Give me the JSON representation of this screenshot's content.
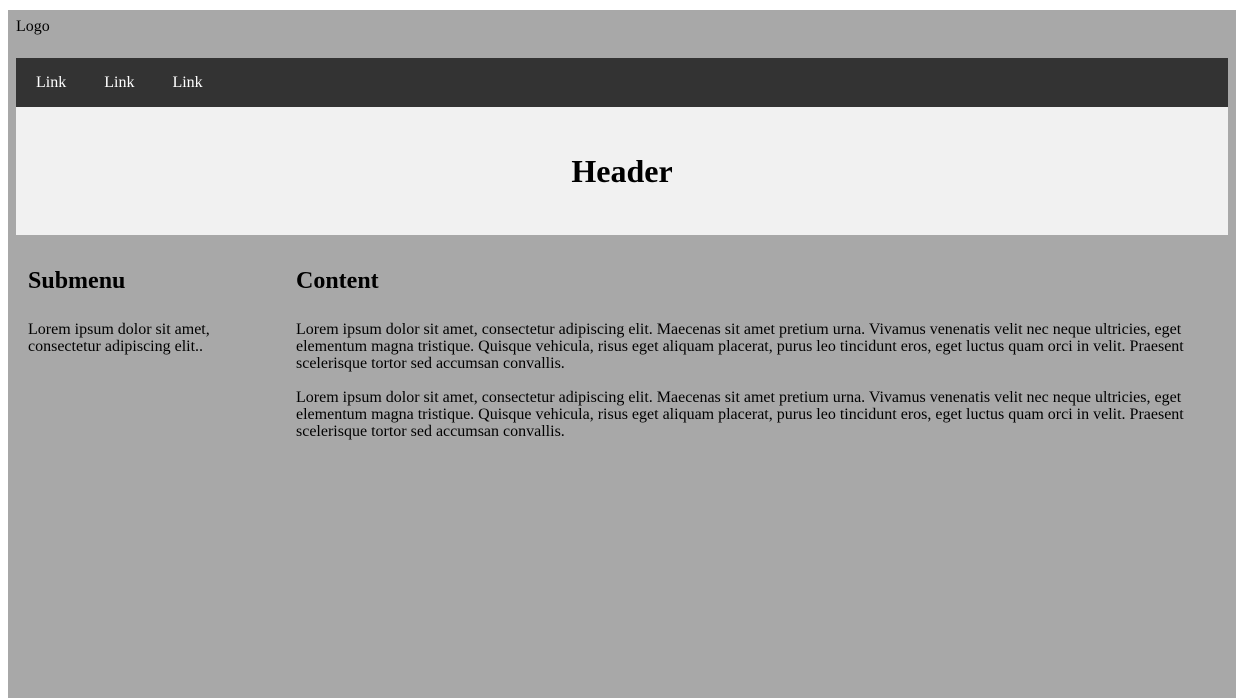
{
  "logo": "Logo",
  "nav": {
    "links": [
      "Link",
      "Link",
      "Link"
    ]
  },
  "header": {
    "title": "Header"
  },
  "submenu": {
    "title": "Submenu",
    "text": "Lorem ipsum dolor sit amet, consectetur adipiscing elit.."
  },
  "content": {
    "title": "Content",
    "paragraphs": [
      "Lorem ipsum dolor sit amet, consectetur adipiscing elit. Maecenas sit amet pretium urna. Vivamus venenatis velit nec neque ultricies, eget elementum magna tristique. Quisque vehicula, risus eget aliquam placerat, purus leo tincidunt eros, eget luctus quam orci in velit. Praesent scelerisque tortor sed accumsan convallis.",
      "Lorem ipsum dolor sit amet, consectetur adipiscing elit. Maecenas sit amet pretium urna. Vivamus venenatis velit nec neque ultricies, eget elementum magna tristique. Quisque vehicula, risus eget aliquam placerat, purus leo tincidunt eros, eget luctus quam orci in velit. Praesent scelerisque tortor sed accumsan convallis."
    ]
  },
  "colors": {
    "page_background": "#a8a8a8",
    "navbar_background": "#333333",
    "header_background": "#f1f1f1"
  }
}
